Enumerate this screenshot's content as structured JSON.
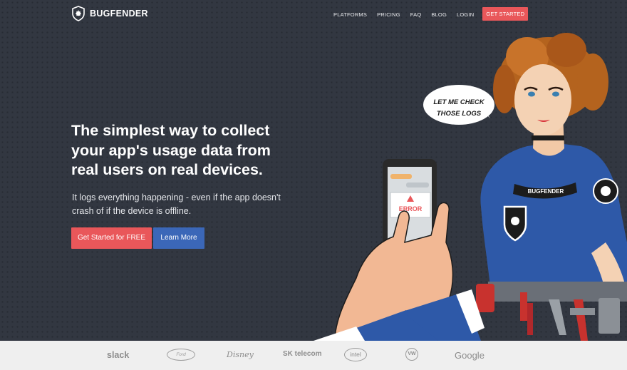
{
  "nav": {
    "brand": "BUGFENDER",
    "links": [
      "PLATFORMS",
      "PRICING",
      "FAQ",
      "BLOG",
      "LOGIN"
    ],
    "cta": "GET STARTED"
  },
  "hero": {
    "headline": "The simplest way to collect your app's usage data from real users on real devices.",
    "subtext": "It logs everything happening - even if the app doesn't crash of if the device is offline.",
    "primary_button": "Get Started for FREE",
    "secondary_button": "Learn More"
  },
  "illustration": {
    "speech_line1": "LET ME CHECK",
    "speech_line2": "THOSE LOGS",
    "phone_error": "ERROR",
    "shirt_text": "BUGFENDER"
  },
  "logos": {
    "slack": "slack",
    "ford": "Ford",
    "disney": "Disney",
    "sk": "SK telecom",
    "intel": "intel",
    "vw": "VW",
    "google": "Google"
  },
  "colors": {
    "background": "#323741",
    "primary": "#e9575a",
    "secondary": "#3b67b8",
    "logo_bar": "#efefef"
  }
}
